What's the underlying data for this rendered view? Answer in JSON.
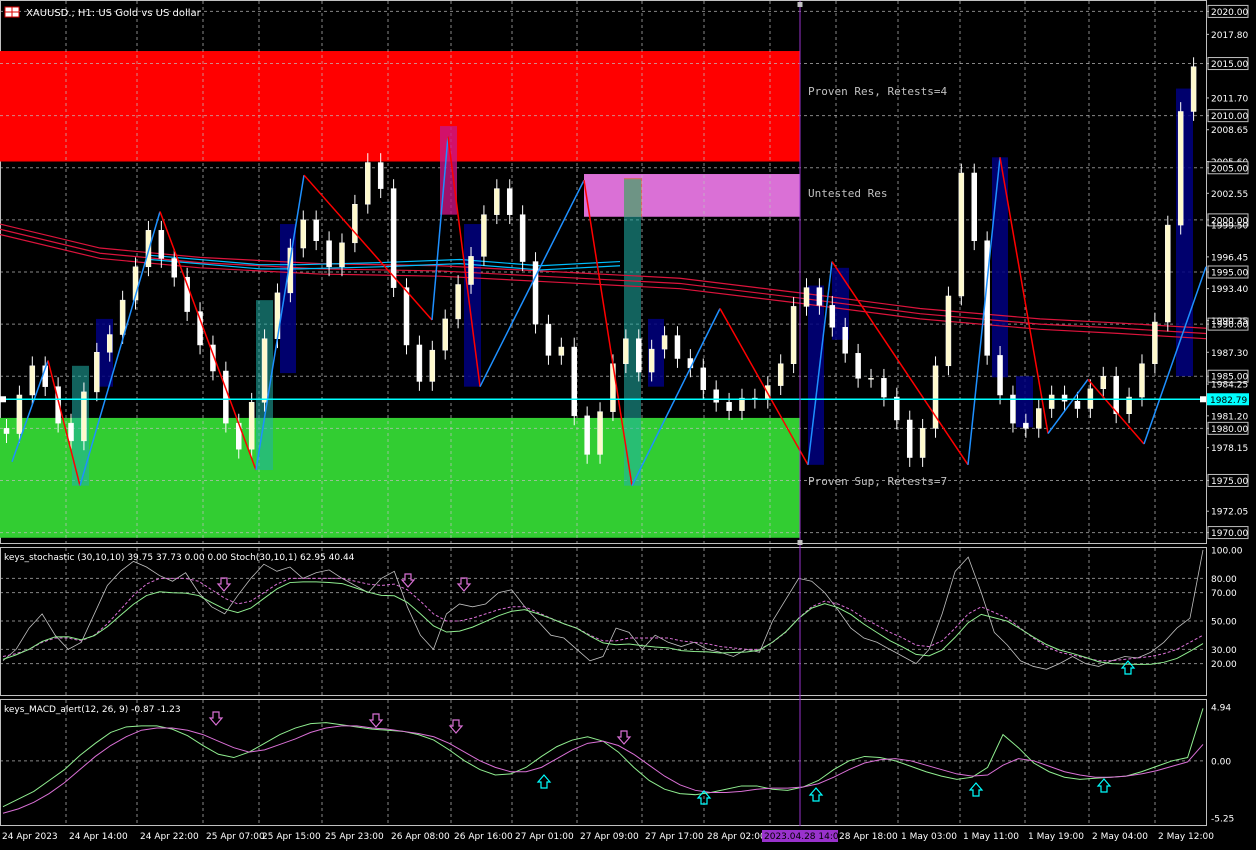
{
  "window": {
    "title": "XAUUSD., H1:  US Gold vs US dollar"
  },
  "main_panel": {
    "y_ticks": [
      "2020.00",
      "2017.80",
      "2015.00",
      "2011.70",
      "2010.00",
      "2008.65",
      "2005.60",
      "2005.00",
      "2002.55",
      "2000.00",
      "1999.50",
      "1996.45",
      "1995.00",
      "1993.40",
      "1990.00",
      "1990.35",
      "1987.30",
      "1985.00",
      "1984.25",
      "1981.20",
      "1980.00",
      "1978.15",
      "1975.00",
      "1972.05",
      "1970.00"
    ],
    "current_price": "1982.79",
    "zones": [
      {
        "label": "Proven Res, Retests=4",
        "color": "#ff0000"
      },
      {
        "label": "Untested Res",
        "color": "#da70d6"
      },
      {
        "label": "Proven Sup, Retests=7",
        "color": "#32cd32"
      }
    ]
  },
  "stoch_panel": {
    "label": "keys_stochastic (30,10,10) 39.75 37.73 0.00 0.00 Stoch(30,10,1) 62.95 40.44",
    "y_ticks": [
      "100.00",
      "80.00",
      "70.00",
      "50.00",
      "30.00",
      "20.00"
    ]
  },
  "macd_panel": {
    "label": "keys_MACD_alert(12, 26, 9) -0.87 -1.23",
    "y_ticks": [
      "4.94",
      "0.00",
      "-5.25"
    ]
  },
  "x_axis": {
    "labels": [
      "24 Apr 2023",
      "24 Apr 14:00",
      "24 Apr 22:00",
      "25 Apr 07:00",
      "25 Apr 15:00",
      "25 Apr 23:00",
      "26 Apr 08:00",
      "26 Apr 16:00",
      "27 Apr 01:00",
      "27 Apr 09:00",
      "27 Apr 17:00",
      "28 Apr 02:00",
      "2023.04.28 14:00",
      "28 Apr 18:00",
      "1 May 03:00",
      "1 May 11:00",
      "1 May 19:00",
      "2 May 04:00",
      "2 May 12:00"
    ]
  },
  "colors": {
    "background": "#000000",
    "grid": "#c0c0c0",
    "bull_candle": "#fffacd",
    "bear_candle": "#ffffff",
    "zigzag_up": "#1e90ff",
    "zigzag_down": "#ff0000",
    "ma": "#dc143c",
    "ma_fast": "#00bfff",
    "price_line": "#00ffff",
    "cursor_line": "#9932cc",
    "highlight_box": "#000080",
    "stoch_main": "#c0c0c0",
    "stoch_signal": "#da70d6",
    "stoch_k": "#90ee90",
    "macd_main": "#90ee90",
    "macd_signal": "#da70d6",
    "arrow_down": "#da70d6",
    "arrow_up": "#00ffff"
  },
  "chart_data": {
    "type": "candlestick",
    "symbol": "XAUUSD.",
    "timeframe": "H1",
    "price_range": [
      1969,
      2021
    ],
    "zones": [
      {
        "name": "Proven Res, Retests=4",
        "from": 2005.6,
        "to": 2016.2
      },
      {
        "name": "Untested Res",
        "from": 2000.3,
        "to": 2004.4
      },
      {
        "name": "Proven Sup, Retests=7",
        "from": 1969.5,
        "to": 1981.0
      }
    ],
    "last_price": 1982.79,
    "zigzag": [
      1976.8,
      1986.5,
      1974.5,
      2000.8,
      1976.0,
      2004.3,
      1990.4,
      2008.0,
      1984.0,
      2003.8,
      1974.5,
      1991.5,
      1976.5,
      1996.0,
      1976.5,
      2006.0,
      1979.5,
      1984.7,
      1978.5,
      1995.5
    ],
    "close": [
      1979.5,
      1983.2,
      1986.0,
      1984.0,
      1980.5,
      1978.8,
      1983.5,
      1987.3,
      1989.0,
      1992.3,
      1995.5,
      1999.0,
      1996.3,
      1994.5,
      1991.2,
      1988.0,
      1985.5,
      1980.5,
      1978.0,
      1982.5,
      1988.6,
      1993.0,
      1997.3,
      2000.0,
      1998.0,
      1995.5,
      1997.8,
      2001.5,
      2005.5,
      2003.0,
      1993.5,
      1988.0,
      1984.5,
      1987.5,
      1990.5,
      1993.8,
      1996.5,
      2000.5,
      2003.0,
      2000.5,
      1996.0,
      1990.0,
      1987.0,
      1987.8,
      1981.2,
      1977.5,
      1981.6,
      1986.2,
      1988.6,
      1985.4,
      1987.6,
      1988.9,
      1986.7,
      1985.8,
      1983.7,
      1982.5,
      1981.7,
      1982.9,
      1982.8,
      1984.1,
      1986.2,
      1991.7,
      1993.5,
      1991.8,
      1989.7,
      1987.2,
      1984.8,
      1984.8,
      1983.0,
      1980.8,
      1977.2,
      1980.0,
      1986.0,
      1992.7,
      2004.5,
      1998.0,
      1987.0,
      1983.2,
      1980.5,
      1980.0,
      1981.9,
      1983.2,
      1982.6,
      1981.9,
      1983.8,
      1985.0,
      1981.4,
      1983.0,
      1986.2,
      1990.2,
      1999.5,
      2010.4,
      2014.7
    ],
    "stoch_main": [
      22,
      30,
      45,
      55,
      40,
      30,
      35,
      55,
      75,
      85,
      92,
      88,
      82,
      78,
      84,
      70,
      60,
      55,
      68,
      80,
      90,
      85,
      88,
      80,
      84,
      86,
      80,
      75,
      70,
      80,
      85,
      60,
      40,
      30,
      55,
      62,
      60,
      62,
      70,
      72,
      60,
      50,
      40,
      38,
      30,
      22,
      25,
      45,
      42,
      30,
      40,
      35,
      32,
      35,
      30,
      28,
      25,
      30,
      28,
      50,
      65,
      80,
      78,
      70,
      58,
      45,
      38,
      35,
      30,
      25,
      20,
      30,
      55,
      85,
      95,
      70,
      42,
      33,
      22,
      18,
      16,
      20,
      25,
      20,
      18,
      22,
      25,
      24,
      28,
      35,
      45,
      52,
      100
    ],
    "stoch_signal": [
      25,
      27,
      30,
      35,
      38,
      38,
      36,
      40,
      48,
      58,
      68,
      76,
      80,
      80,
      80,
      78,
      72,
      66,
      62,
      64,
      70,
      76,
      80,
      80,
      80,
      80,
      80,
      78,
      76,
      75,
      76,
      72,
      64,
      55,
      50,
      50,
      52,
      55,
      58,
      60,
      60,
      56,
      52,
      48,
      45,
      40,
      36,
      36,
      38,
      38,
      38,
      38,
      36,
      35,
      34,
      32,
      31,
      30,
      30,
      35,
      42,
      52,
      60,
      64,
      62,
      58,
      52,
      47,
      42,
      38,
      33,
      32,
      36,
      45,
      55,
      60,
      56,
      52,
      45,
      38,
      32,
      28,
      26,
      24,
      22,
      22,
      23,
      24,
      25,
      27,
      30,
      35,
      40
    ],
    "macd_main": [
      -4.2,
      -3.5,
      -2.8,
      -1.8,
      -0.8,
      0.5,
      1.6,
      2.6,
      3.1,
      3.2,
      3.2,
      2.9,
      2.3,
      1.4,
      0.6,
      0.3,
      0.8,
      1.6,
      2.4,
      3.0,
      3.4,
      3.5,
      3.3,
      3.1,
      2.9,
      2.8,
      2.7,
      2.4,
      1.9,
      1.0,
      0.0,
      -0.8,
      -1.3,
      -1.2,
      -0.6,
      0.4,
      1.3,
      1.9,
      2.2,
      1.8,
      0.8,
      -0.6,
      -1.8,
      -2.6,
      -3.0,
      -3.1,
      -2.9,
      -2.6,
      -2.3,
      -2.3,
      -2.6,
      -2.7,
      -2.4,
      -1.8,
      -0.8,
      0.0,
      0.4,
      0.3,
      0.0,
      -0.5,
      -1.0,
      -1.4,
      -1.7,
      -1.5,
      -0.6,
      2.4,
      1.2,
      -0.2,
      -1.0,
      -1.5,
      -1.7,
      -1.6,
      -1.5,
      -1.4,
      -1.0,
      -0.5,
      0.0,
      0.3,
      4.8
    ],
    "macd_signal": [
      -4.8,
      -4.4,
      -3.8,
      -3.0,
      -2.0,
      -0.8,
      0.4,
      1.4,
      2.2,
      2.8,
      3.0,
      3.0,
      2.8,
      2.4,
      1.8,
      1.2,
      0.8,
      1.0,
      1.5,
      2.0,
      2.6,
      3.0,
      3.2,
      3.2,
      3.0,
      2.9,
      2.7,
      2.5,
      2.2,
      1.6,
      0.8,
      0.0,
      -0.6,
      -1.0,
      -1.0,
      -0.6,
      0.2,
      1.0,
      1.6,
      1.8,
      1.4,
      0.6,
      -0.4,
      -1.4,
      -2.2,
      -2.7,
      -2.9,
      -2.9,
      -2.8,
      -2.6,
      -2.5,
      -2.5,
      -2.4,
      -2.1,
      -1.5,
      -0.8,
      -0.2,
      0.1,
      0.2,
      0.0,
      -0.4,
      -0.8,
      -1.2,
      -1.4,
      -1.3,
      -0.4,
      0.2,
      0.0,
      -0.5,
      -1.0,
      -1.3,
      -1.5,
      -1.5,
      -1.4,
      -1.2,
      -0.9,
      -0.5,
      -0.1,
      1.5
    ]
  }
}
